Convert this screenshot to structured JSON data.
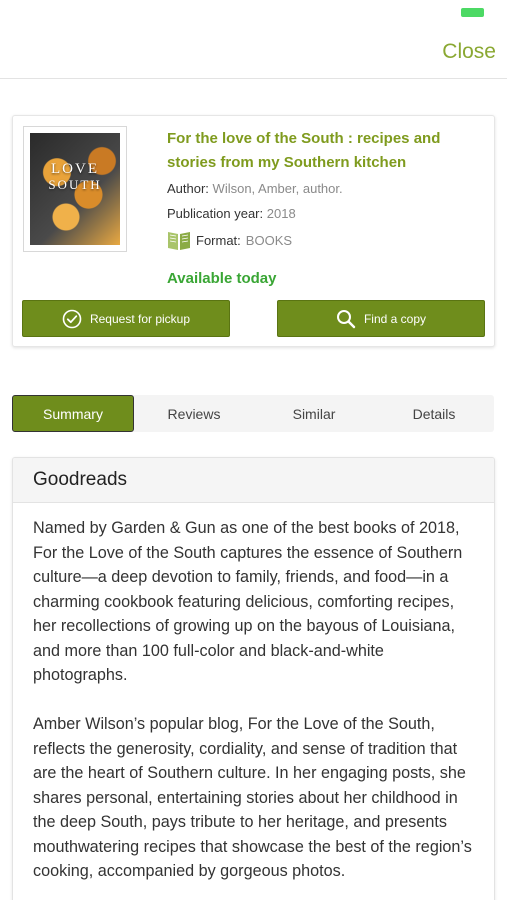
{
  "header": {
    "close_label": "Close"
  },
  "book": {
    "title": "For the love of the South : recipes and stories from my Southern kitchen",
    "cover_text_line1": "LOVE",
    "cover_text_line2": "SOUTH",
    "author_label": "Author:",
    "author_value": "Wilson, Amber, author.",
    "year_label": "Publication year:",
    "year_value": "2018",
    "format_label": "Format:",
    "format_value": "BOOKS",
    "format_icon": "book-icon",
    "availability": "Available today",
    "request_label": "Request for pickup",
    "find_label": "Find a copy"
  },
  "tabs": [
    {
      "label": "Summary",
      "active": true
    },
    {
      "label": "Reviews",
      "active": false
    },
    {
      "label": "Similar",
      "active": false
    },
    {
      "label": "Details",
      "active": false
    }
  ],
  "summary": {
    "heading": "Goodreads",
    "paragraphs": [
      "Named by Garden & Gun as one of the best books of 2018, For the Love of the South captures the essence of Southern culture—a deep devotion to family, friends, and food—in a charming cookbook featuring delicious, comforting recipes, her recollections of growing up on the bayous of Louisiana, and more than 100 full-color and black-and-white photographs.",
      "Amber Wilson’s popular blog, For the Love of the South, reflects the generosity, cordiality, and sense of tradition that are the heart of Southern culture. In her engaging posts, she shares personal, entertaining stories about her childhood in the deep South, pays tribute to her heritage, and presents mouthwatering recipes that showcase the best of the region’s cooking, accompanied by gorgeous photos."
    ]
  },
  "colors": {
    "accent_green": "#6f8d1c",
    "title_green": "#7f9b1e",
    "available_green": "#3aa635",
    "close_green": "#8aa832"
  }
}
